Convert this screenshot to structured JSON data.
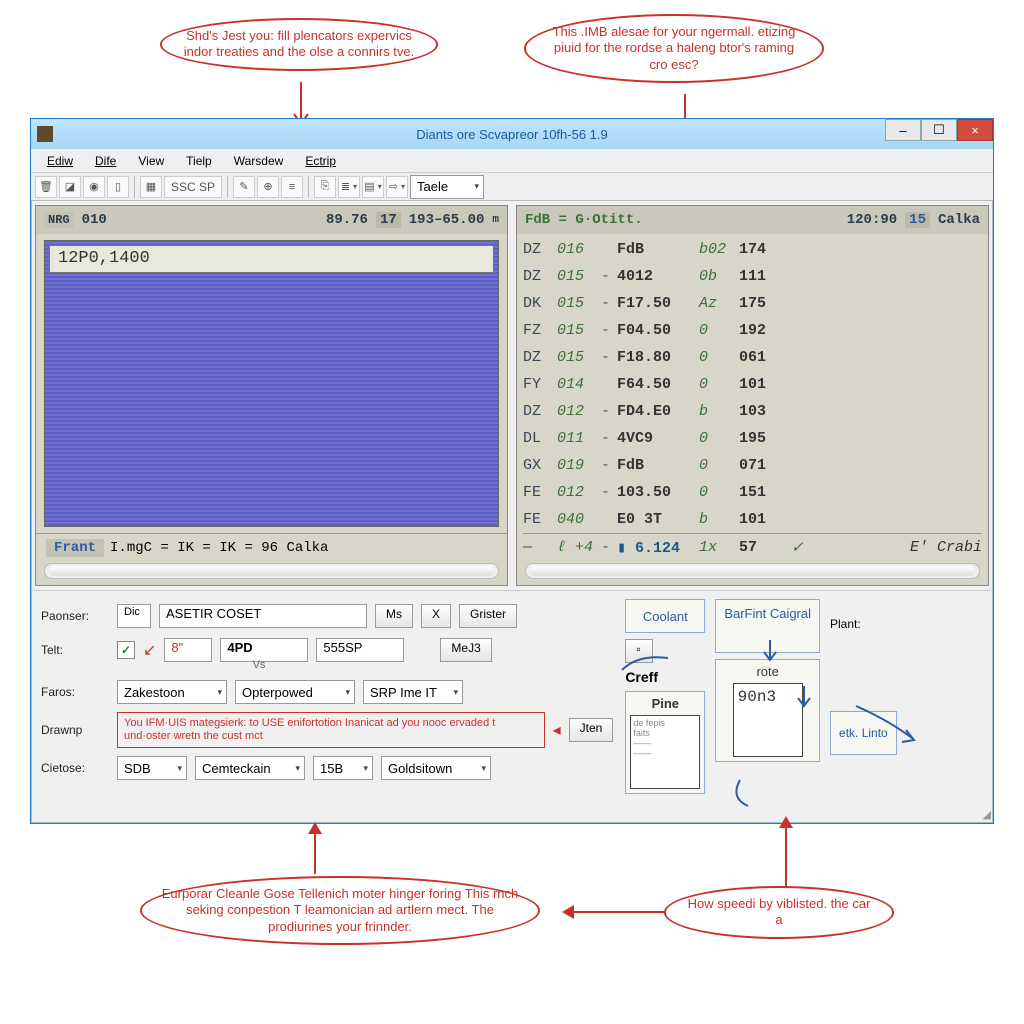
{
  "callouts": {
    "top_left": "Shd's Jest you: fill plencators expervics indor treaties and the olse a connirs tve.",
    "top_right": "This .IMB alesae for your ngermall. etizing piuid for the rordse a haleng btor's raming cro esc?",
    "bottom_left": "Eurporar Cleanle Gose Tellenich moter hinger foring This rnch seking conpestion T leamonician ad artlern mect. The prodiurines your frinnder.",
    "bottom_right": "How speedi by viblisted. the car a"
  },
  "window": {
    "title": "Diants ore Scvapreor 10fh-56 1.9",
    "min_tip": "–",
    "max_tip": "☐",
    "close_tip": "×"
  },
  "menu": {
    "items": [
      "Ediw",
      "Dife",
      "View",
      "Tielp",
      "Warsdew",
      "Ectrip"
    ],
    "underline": [
      0,
      0,
      0,
      0,
      0,
      0
    ]
  },
  "toolbar": {
    "ssp": "SSC SP",
    "taele": "Taele"
  },
  "left_panel": {
    "header_tag": "NRG",
    "header_a": "010",
    "header_b": "89.76",
    "header_c": "17",
    "header_d": "193–65.00",
    "header_e": "m",
    "input_value": "12P0,1400",
    "footer_label": "Frant",
    "footer_expr": "I.mgC = IK  = IK  = 96 Calka"
  },
  "right_panel": {
    "header_fdb": "FdB = G·Otitt.",
    "header_num": "120:90",
    "header_blue": "15",
    "header_txt": "Calka",
    "rows": [
      {
        "a": "DZ",
        "b": "016",
        "c": "",
        "d": "FdB",
        "e": "b02",
        "f": "174"
      },
      {
        "a": "DZ",
        "b": "015",
        "c": "-",
        "d": "4012",
        "e": "0b",
        "f": "111"
      },
      {
        "a": "DK",
        "b": "015",
        "c": "-",
        "d": "F17.50",
        "e": "Az",
        "f": "175"
      },
      {
        "a": "FZ",
        "b": "015",
        "c": "-",
        "d": "F04.50",
        "e": "0",
        "f": "192"
      },
      {
        "a": "DZ",
        "b": "015",
        "c": "-",
        "d": "F18.80",
        "e": "0",
        "f": "061"
      },
      {
        "a": "FY",
        "b": "014",
        "c": "",
        "d": "F64.50",
        "e": "0",
        "f": "101"
      },
      {
        "a": "DZ",
        "b": "012",
        "c": "-",
        "d": "FD4.E0",
        "e": "b",
        "f": "103"
      },
      {
        "a": "DL",
        "b": "011",
        "c": "-",
        "d": "4VC9",
        "e": "0",
        "f": "195"
      },
      {
        "a": "GX",
        "b": "019",
        "c": "-",
        "d": "FdB",
        "e": "0",
        "f": "071"
      },
      {
        "a": "FE",
        "b": "012",
        "c": "-",
        "d": "103.50",
        "e": "0",
        "f": "151"
      },
      {
        "a": "FE",
        "b": "040",
        "c": "",
        "d": "E0 3T",
        "e": "b",
        "f": "101"
      }
    ],
    "totals": {
      "a": "—",
      "b": "ℓ +4",
      "c": "-",
      "d": "▮ 6.124",
      "e": "1x",
      "f": "57",
      "chk": "✓",
      "end": "E' Crabi"
    }
  },
  "form": {
    "paonser_label": "Paonser:",
    "paonser_tag": "Dic",
    "paonser_value": "ASETIR COSET",
    "paonser_btn1": "Ms",
    "paonser_btn2": "X",
    "grister_btn": "Grister",
    "telt_label": "Telt:",
    "telt_checked": "✓",
    "telt_a": "8\"",
    "telt_b": "4PD",
    "telt_c": "555SP",
    "mej_btn": "MeJ3",
    "vs_label": "Vs",
    "faros_label": "Faros:",
    "faros_a": "Zakestoon",
    "faros_b": "Opterpowed",
    "faros_c": "SRP Ime IT",
    "drawnp_label": "Drawnp",
    "drawnp_note": "You IFM·UIS mategsierk: to USE enifortotion Inanicat ad you nooc ervaded t und·oster wretn the cust mct",
    "jten_btn": "Jten",
    "getose_label": "Cietose:",
    "getose_a": "SDB",
    "getose_b": "Cemteckain",
    "getose_c": "15B",
    "getose_d": "Goldsitown"
  },
  "side_boxes": {
    "coolant": "Coolant",
    "creff": "Creff",
    "pine": "Pine",
    "barfint": "BarFint Caigral",
    "rote": "rote",
    "rote_val": "90n3",
    "plant": "Plant:",
    "etk": "etk. Linto"
  }
}
